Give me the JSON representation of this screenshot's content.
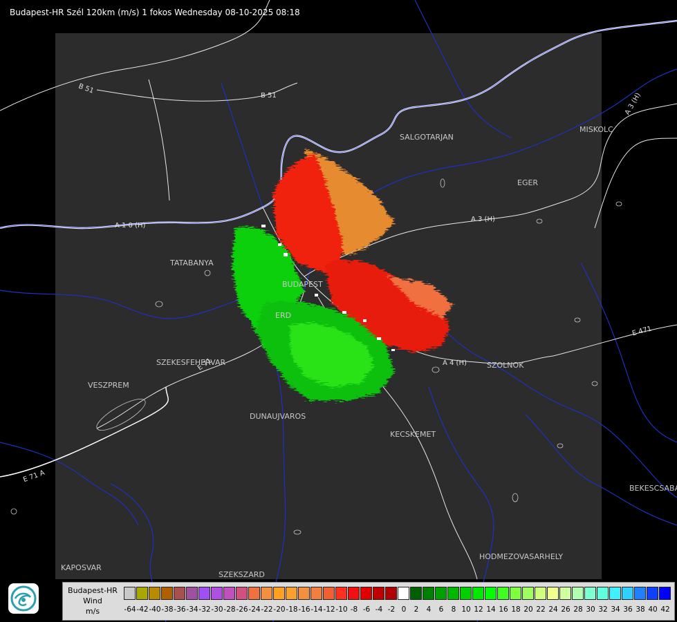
{
  "title": "Budapest-HR Szél 120km (m/s) 1 fokos Wednesday 08-10-2025 08:18",
  "cities": [
    {
      "key": "salgotarjan",
      "label": "SALGOTARJAN"
    },
    {
      "key": "miskolc",
      "label": "MISKOLC"
    },
    {
      "key": "eger",
      "label": "EGER"
    },
    {
      "key": "tatabanya",
      "label": "TATABANYA"
    },
    {
      "key": "budapest",
      "label": "BUDAPEST"
    },
    {
      "key": "erd",
      "label": "ERD"
    },
    {
      "key": "szekesfehervar",
      "label": "SZEKESFEHERVAR"
    },
    {
      "key": "veszprem",
      "label": "VESZPREM"
    },
    {
      "key": "dunaujvaros",
      "label": "DUNAUJVAROS"
    },
    {
      "key": "kecskemet",
      "label": "KECSKEMET"
    },
    {
      "key": "szolnok",
      "label": "SZOLNOK"
    },
    {
      "key": "bekescsaba",
      "label": "BEKESCSABA"
    },
    {
      "key": "hodmezovasarhely",
      "label": "HODMEZOVASARHELY"
    },
    {
      "key": "kaposvar",
      "label": "KAPOSVAR"
    },
    {
      "key": "szekszard",
      "label": "SZEKSZARD"
    }
  ],
  "roads": [
    {
      "key": "b51a",
      "label": "B 51"
    },
    {
      "key": "b51b",
      "label": "B 51"
    },
    {
      "key": "a3",
      "label": "A 3 (H)"
    },
    {
      "key": "a3b",
      "label": "A 3 (H)"
    },
    {
      "key": "a1",
      "label": "A 1 0 (H)"
    },
    {
      "key": "a4",
      "label": "A 4 (H)"
    },
    {
      "key": "e71",
      "label": "E 71 A"
    },
    {
      "key": "e71b",
      "label": "E 71"
    },
    {
      "key": "e471",
      "label": "E 471"
    }
  ],
  "legend": {
    "line1": "Budapest-HR",
    "line2": "Wind",
    "line3": "m/s",
    "ticks": [
      "-64",
      "-42",
      "-40",
      "-38",
      "-36",
      "-34",
      "-32",
      "-30",
      "-28",
      "-26",
      "-24",
      "-22",
      "-20",
      "-18",
      "-16",
      "-14",
      "-12",
      "-10",
      "-8",
      "-6",
      "-4",
      "-2",
      "0",
      "2",
      "4",
      "6",
      "8",
      "10",
      "12",
      "14",
      "16",
      "18",
      "20",
      "22",
      "24",
      "26",
      "28",
      "30",
      "32",
      "34",
      "36",
      "38",
      "40",
      "42"
    ],
    "colors": [
      "#c8c8c8",
      "#a8a800",
      "#b88a00",
      "#b06000",
      "#a85050",
      "#a050a0",
      "#a050f0",
      "#b050e0",
      "#c050c0",
      "#d05080",
      "#f07040",
      "#f09040",
      "#ffa020",
      "#f8a030",
      "#f09040",
      "#f08040",
      "#f06030",
      "#ff3020",
      "#f01010",
      "#e00000",
      "#c00000",
      "#b00000",
      "#ffffff",
      "#006000",
      "#008000",
      "#00a000",
      "#00b800",
      "#00d000",
      "#00e800",
      "#00ff00",
      "#40ff20",
      "#80ff40",
      "#a0ff60",
      "#d0ff80",
      "#f0ff90",
      "#d0ffa0",
      "#b0ffb0",
      "#80ffd0",
      "#60ffe0",
      "#40f0ff",
      "#30d0ff",
      "#2080ff",
      "#1040ff",
      "#0000ff"
    ]
  },
  "logo_icon": "weather-service-logo-icon"
}
